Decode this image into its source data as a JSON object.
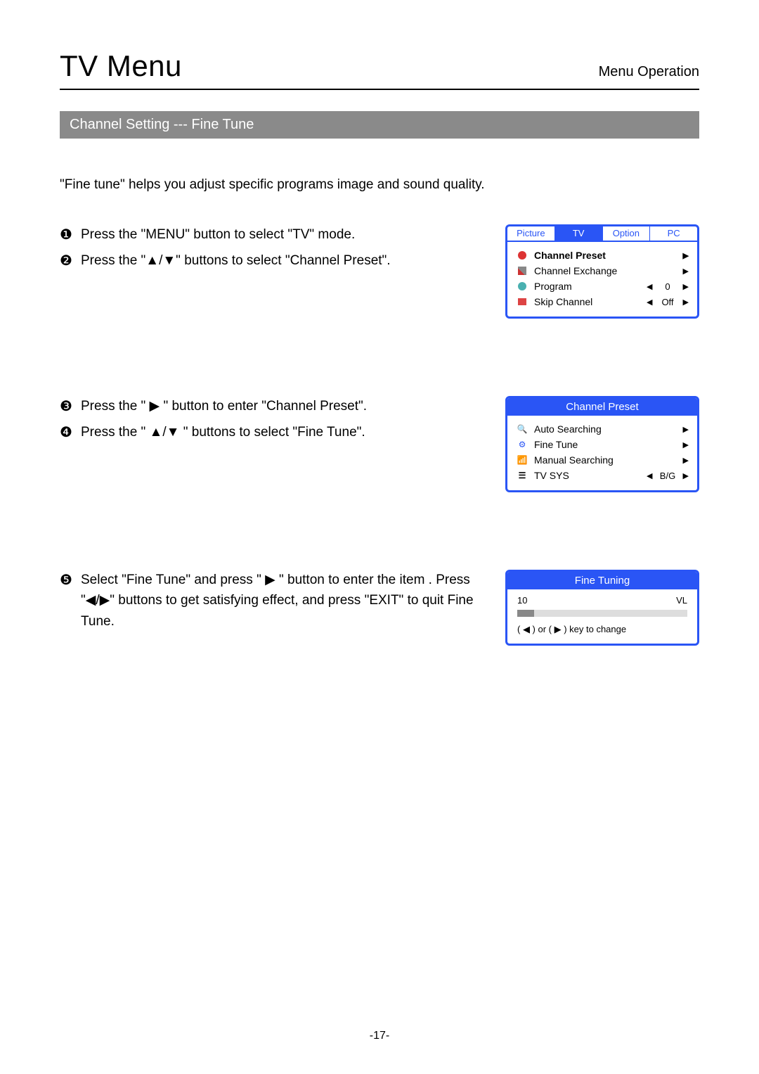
{
  "header": {
    "title": "TV Menu",
    "subtitle": "Menu Operation"
  },
  "section_title": "Channel Setting --- Fine Tune",
  "intro": "\"Fine tune\" helps you adjust specific programs image and sound quality.",
  "steps": {
    "s1": {
      "bullet": "❶",
      "text": "Press the \"MENU\" button to select \"TV\" mode."
    },
    "s2": {
      "bullet": "❷",
      "text": "Press the \"▲/▼\" buttons to select \"Channel Preset\"."
    },
    "s3": {
      "bullet": "❸",
      "text": "Press the \" ▶ \" button to enter \"Channel Preset\"."
    },
    "s4": {
      "bullet": "❹",
      "text": "Press the \" ▲/▼ \" buttons to select \"Fine Tune\"."
    },
    "s5": {
      "bullet": "❺",
      "text": "Select \"Fine Tune\" and press \" ▶ \" button to enter the item . Press \"◀/▶\" buttons to get satisfying effect, and press \"EXIT\" to quit Fine Tune."
    }
  },
  "menu1": {
    "tabs": {
      "picture": "Picture",
      "tv": "TV",
      "option": "Option",
      "pc": "PC"
    },
    "items": {
      "channel_preset": {
        "label": "Channel Preset"
      },
      "channel_exchange": {
        "label": "Channel Exchange"
      },
      "program": {
        "label": "Program",
        "value": "0"
      },
      "skip_channel": {
        "label": "Skip Channel",
        "value": "Off"
      }
    }
  },
  "menu2": {
    "title": "Channel Preset",
    "items": {
      "auto_searching": {
        "label": "Auto Searching"
      },
      "fine_tune": {
        "label": "Fine Tune"
      },
      "manual_searching": {
        "label": "Manual Searching"
      },
      "tv_sys": {
        "label": "TV SYS",
        "value": "B/G"
      }
    }
  },
  "menu3": {
    "title": "Fine Tuning",
    "left": "10",
    "right": "VL",
    "hint": "( ◀ ) or ( ▶ ) key to change"
  },
  "page_number": "-17-"
}
